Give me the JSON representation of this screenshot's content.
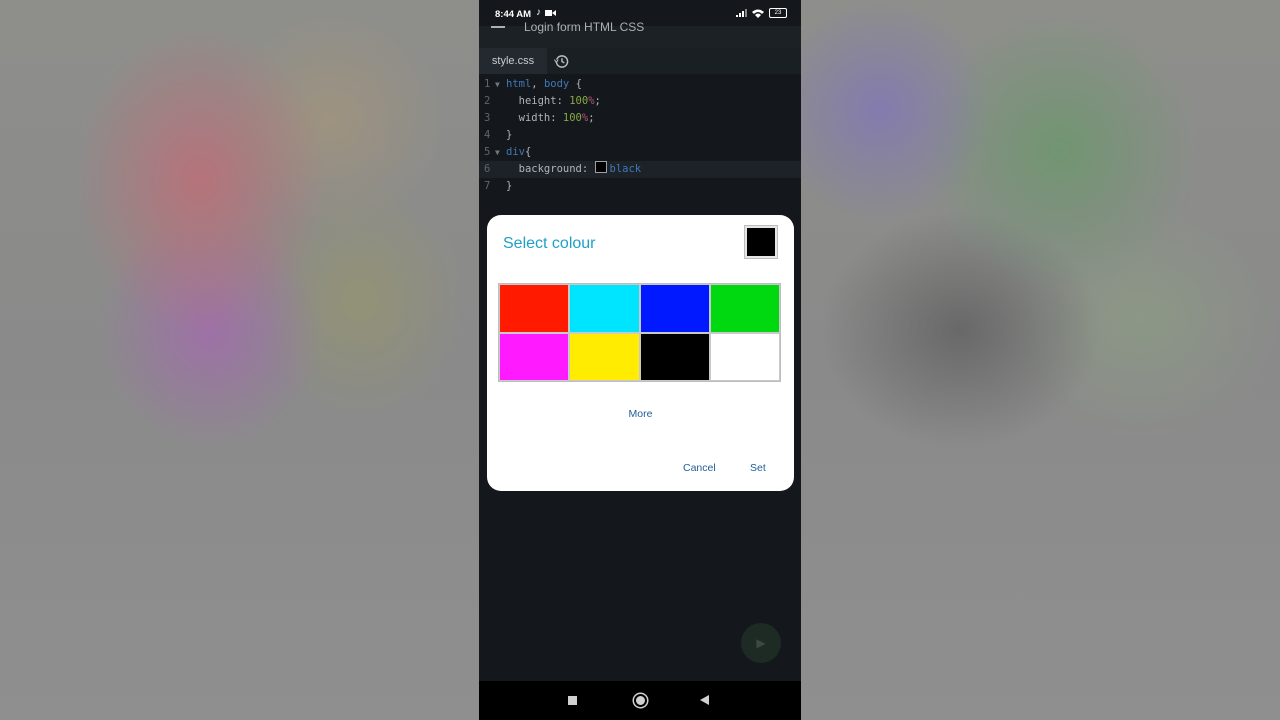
{
  "status": {
    "time": "8:44 AM",
    "battery": "23"
  },
  "app": {
    "title": "Login form HTML CSS"
  },
  "tab": {
    "label": "style.css"
  },
  "editor": {
    "lines": [
      {
        "n": "1",
        "fold": "▼"
      },
      {
        "n": "2",
        "fold": ""
      },
      {
        "n": "3",
        "fold": ""
      },
      {
        "n": "4",
        "fold": ""
      },
      {
        "n": "5",
        "fold": "▼"
      },
      {
        "n": "6",
        "fold": ""
      },
      {
        "n": "7",
        "fold": ""
      }
    ],
    "tokens": {
      "l1_sel1": "html",
      "l1_sep": ", ",
      "l1_sel2": "body",
      "l1_rest": " {",
      "l2_prop": "  height: ",
      "l2_num": "100",
      "l2_pct": "%",
      "l2_end": ";",
      "l3_prop": "  width: ",
      "l3_num": "100",
      "l3_pct": "%",
      "l3_end": ";",
      "l4": "}",
      "l5_sel": "div",
      "l5_rest": "{",
      "l6_prop": "  background: ",
      "l6_val": "black",
      "l7": "}"
    }
  },
  "dialog": {
    "title": "Select colour",
    "selected_color": "#000000",
    "palette": [
      "#ff1a00",
      "#00e5ff",
      "#0019ff",
      "#00d90f",
      "#ff1aff",
      "#ffec00",
      "#000000",
      "#ffffff"
    ],
    "more_label": "More",
    "cancel_label": "Cancel",
    "set_label": "Set"
  },
  "colors": {
    "accent": "#1fa0c8",
    "button_text": "#1f5d9a",
    "editor_bg": "#14181c"
  }
}
